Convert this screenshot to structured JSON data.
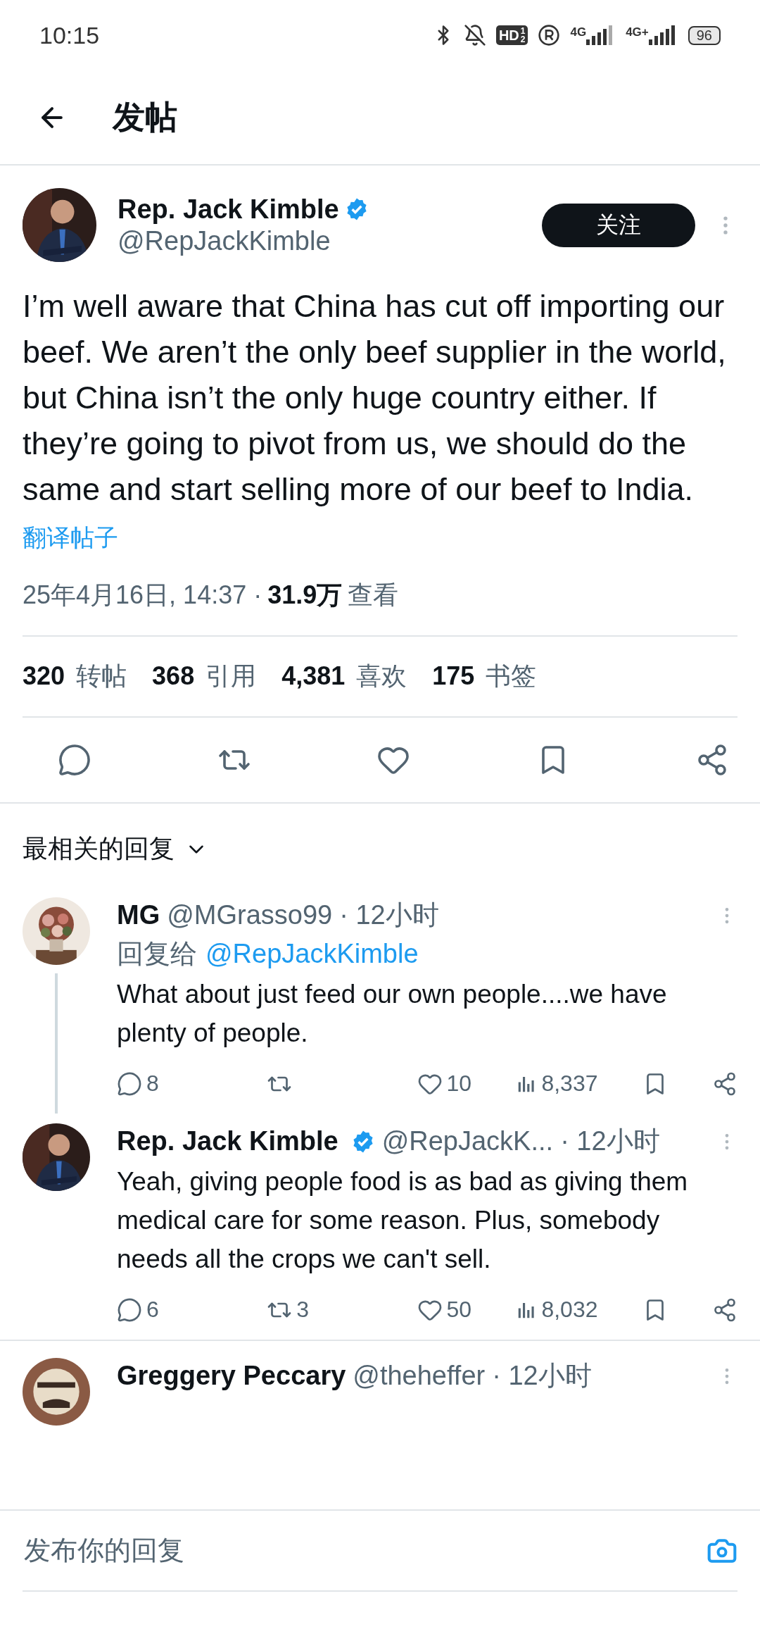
{
  "status_bar": {
    "time": "10:15",
    "hd": "HD",
    "hd_slots": [
      "1",
      "2"
    ],
    "networks": [
      "4G",
      "4G+"
    ],
    "battery": "96"
  },
  "header": {
    "title": "发帖"
  },
  "post": {
    "author": "Rep. Jack Kimble",
    "verified": true,
    "handle": "@RepJackKimble",
    "follow": "关注",
    "text": "I’m well aware that China has cut off importing our beef. We aren’t the only beef supplier in the world, but China isn’t the only huge country either. If they’re going to pivot from us, we should do the same and start selling more of our beef to India.",
    "translate": "翻译帖子",
    "date": "25年4月16日, 14:37 ·",
    "views": "31.9万",
    "views_label": "查看",
    "stats": [
      "**320** 转帖",
      "**368** 引用",
      "**4,381** 喜欢",
      "**175** 书签"
    ]
  },
  "replies_header": {
    "label": "最相关的回复"
  },
  "replies": [
    {
      "author": "MG",
      "verified": false,
      "handle": "@MGrasso99",
      "time": "· 12小时",
      "reply_to_label": "回复给",
      "reply_to": "@RepJackKimble",
      "text": "What about just feed our own people....we have plenty of people.",
      "thread_line": true,
      "counts": {
        "replies": "8",
        "likes": "10",
        "views": "8,337"
      }
    },
    {
      "author": "Rep. Jack Kimble",
      "verified": true,
      "handle": "@RepJackK...",
      "time": "· 12小时",
      "text": "Yeah, giving people food is as bad as giving them medical care for some reason. Plus, somebody needs all the crops we can't sell.",
      "thread_line": false,
      "counts": {
        "replies": "6",
        "reposts": "3",
        "likes": "50",
        "views": "8,032"
      }
    },
    {
      "author": "Greggery Peccary",
      "verified": false,
      "handle": "@theheffer",
      "time": "· 12小时",
      "thread_line": false
    }
  ],
  "composer": {
    "placeholder": "发布你的回复"
  }
}
